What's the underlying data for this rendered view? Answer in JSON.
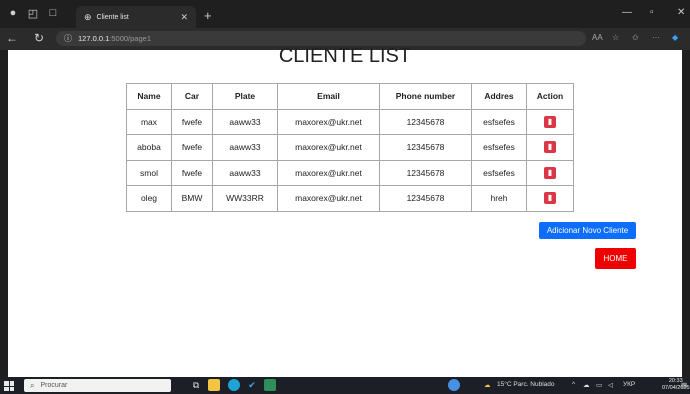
{
  "browser": {
    "tab_title": "Cliente list",
    "url_host": "127.0.0.1",
    "url_path": ":5000/page1",
    "zoom_badge": "AА"
  },
  "page": {
    "title": "CLIENTE LIST",
    "columns": [
      "Name",
      "Car",
      "Plate",
      "Email",
      "Phone number",
      "Addres",
      "Action"
    ],
    "rows": [
      {
        "name": "max",
        "car": "fwefe",
        "plate": "aaww33",
        "email": "maxorex@ukr.net",
        "phone": "12345678",
        "address": "esfsefes"
      },
      {
        "name": "aboba",
        "car": "fwefe",
        "plate": "aaww33",
        "email": "maxorex@ukr.net",
        "phone": "12345678",
        "address": "esfsefes"
      },
      {
        "name": "smol",
        "car": "fwefe",
        "plate": "aaww33",
        "email": "maxorex@ukr.net",
        "phone": "12345678",
        "address": "esfsefes"
      },
      {
        "name": "oleg",
        "car": "BMW",
        "plate": "WW33RR",
        "email": "maxorex@ukr.net",
        "phone": "12345678",
        "address": "hreh"
      }
    ],
    "add_button": "Adicionar Novo Cliente",
    "home_button": "HOME"
  },
  "taskbar": {
    "search_placeholder": "Procurar",
    "weather": "15°C  Parc. Nublado",
    "lang": "УКР",
    "time": "20:33",
    "date": "07/04/2025"
  },
  "colors": {
    "add_button": "#0d6efd",
    "home_button": "#ee0000",
    "delete_button": "#dc3545"
  }
}
